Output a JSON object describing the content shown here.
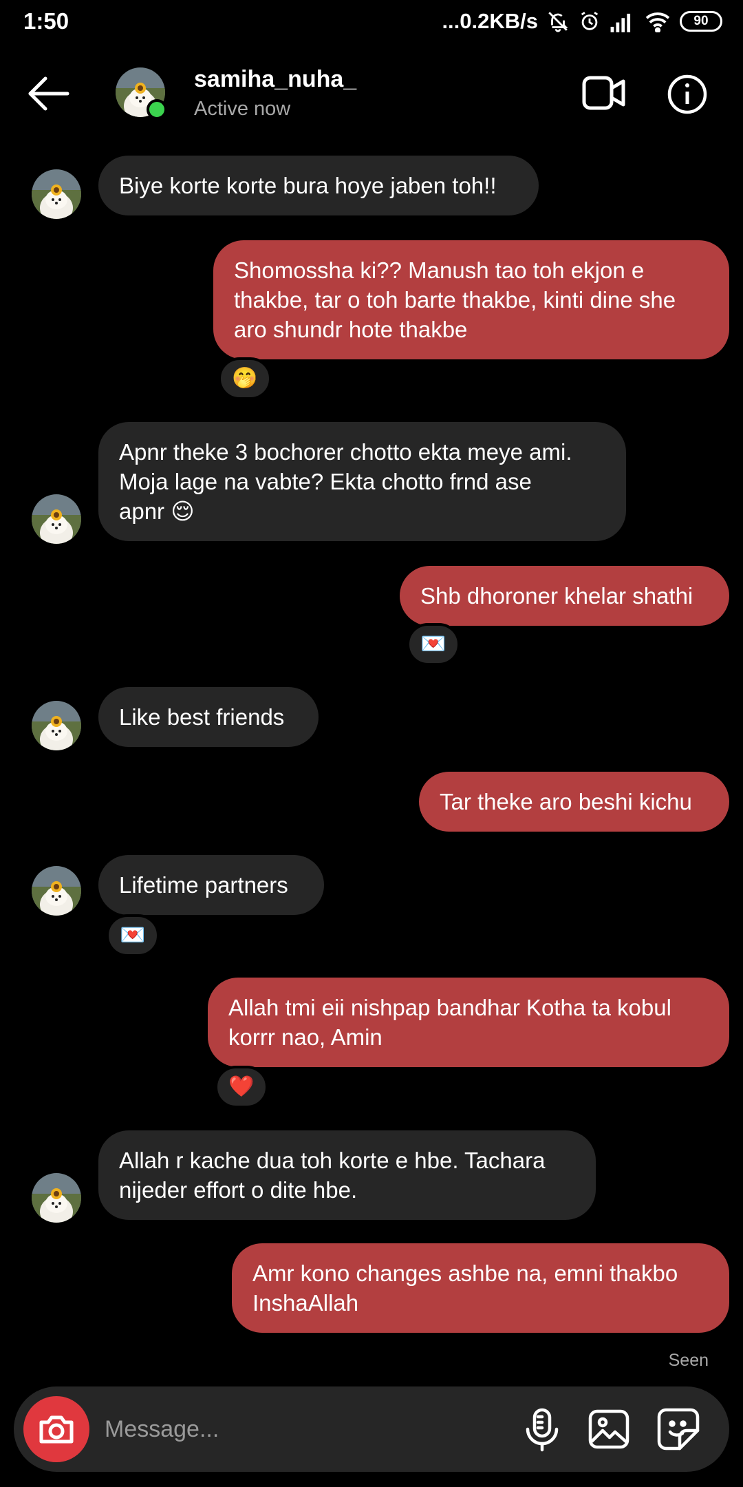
{
  "status_bar": {
    "time": "1:50",
    "network_speed": "...0.2KB/s",
    "battery": "90",
    "icons": [
      "mute-bell-icon",
      "alarm-icon",
      "signal-icon",
      "wifi-icon",
      "battery-icon"
    ]
  },
  "header": {
    "username": "samiha_nuha_",
    "status": "Active now",
    "online_color": "#3bd34e"
  },
  "colors": {
    "incoming_bubble": "#262626",
    "outgoing_bubble": "#b33f40",
    "camera_button": "#e0383e"
  },
  "messages": [
    {
      "dir": "in",
      "lines": [
        "Biye korte korte bura hoye jaben toh!!"
      ]
    },
    {
      "dir": "out",
      "lines": [
        "Shomossha ki?? Manush tao toh ekjon e",
        "thakbe, tar o toh barte thakbe, kinti dine she",
        "aro shundr hote thakbe"
      ],
      "reaction": "🤭"
    },
    {
      "dir": "in",
      "lines": [
        "Apnr theke 3 bochorer chotto ekta meye ami.",
        "Moja lage na vabte? Ekta chotto frnd ase",
        "apnr 😌"
      ]
    },
    {
      "dir": "out",
      "lines": [
        "Shb dhoroner khelar shathi"
      ],
      "reaction": "💌"
    },
    {
      "dir": "in",
      "lines": [
        "Like best friends"
      ]
    },
    {
      "dir": "out",
      "lines": [
        "Tar theke aro beshi kichu"
      ]
    },
    {
      "dir": "in",
      "lines": [
        "Lifetime partners"
      ],
      "reaction": "💌"
    },
    {
      "dir": "out",
      "lines": [
        "Allah tmi eii nishpap bandhar Kotha ta kobul",
        "korrr nao, Amin"
      ],
      "reaction": "❤️"
    },
    {
      "dir": "in",
      "lines": [
        "Allah r kache dua toh korte e hbe. Tachara",
        "nijeder effort o dite hbe."
      ]
    },
    {
      "dir": "out",
      "lines": [
        "Amr kono changes ashbe na, emni thakbo",
        "InshaAllah"
      ]
    }
  ],
  "seen_label": "Seen",
  "composer": {
    "placeholder": "Message..."
  }
}
